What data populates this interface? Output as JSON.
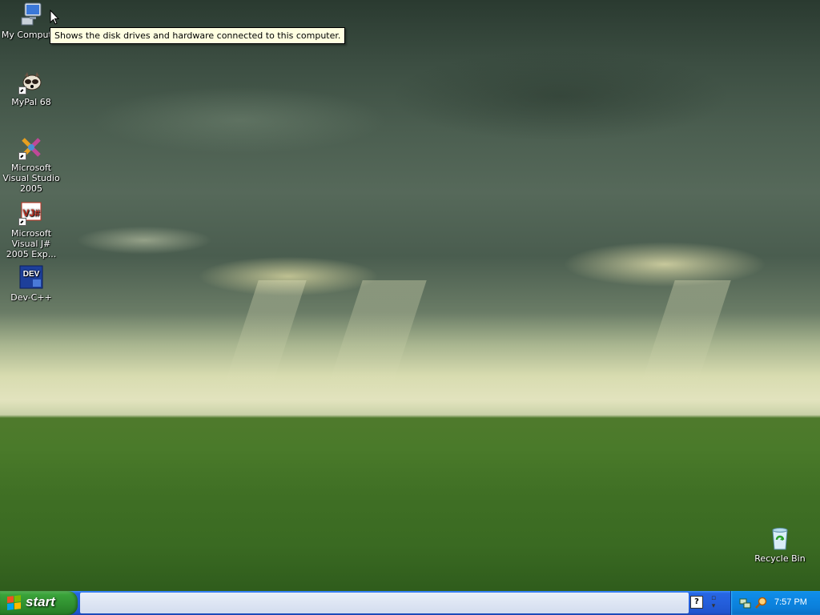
{
  "desktop": {
    "icons": [
      {
        "label": "My Computer"
      },
      {
        "label": "MyPal 68"
      },
      {
        "label": "Microsoft Visual Studio 2005"
      },
      {
        "label": "Microsoft Visual J# 2005 Exp..."
      },
      {
        "label": "Dev-C++"
      },
      {
        "label": "Recycle Bin"
      }
    ],
    "tooltip": "Shows the disk drives and hardware connected to this computer."
  },
  "taskbar": {
    "start_label": "start",
    "clock": "7:57 PM"
  },
  "colors": {
    "taskbar_blue": "#245edb",
    "start_green": "#3aa33a",
    "tray_blue": "#0b7fda",
    "tooltip_bg": "#ffffe1"
  }
}
